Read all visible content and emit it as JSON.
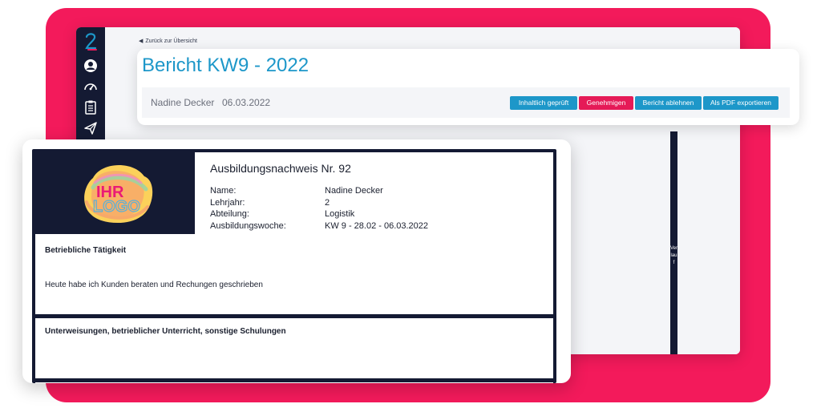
{
  "app": {
    "back_link": "Zurück zur Übersicht",
    "sidebar_icons": [
      "brand-logo-icon",
      "profile-icon",
      "dashboard-icon",
      "clipboard-icon",
      "send-icon"
    ],
    "side_panel_label": "Verlauf"
  },
  "header": {
    "title": "Bericht KW9 - 2022",
    "student_name": "Nadine Decker",
    "date": "06.03.2022",
    "buttons": {
      "checked": "Inhaltlich geprüft",
      "approve": "Genehmigen",
      "reject": "Bericht ablehnen",
      "export_pdf": "Als PDF exportieren"
    }
  },
  "document": {
    "logo_line1": "IHR",
    "logo_line2": "LOGO",
    "title": "Ausbildungsnachweis Nr. 92",
    "fields": [
      {
        "label": "Name:",
        "value": "Nadine Decker"
      },
      {
        "label": "Lehrjahr:",
        "value": "2"
      },
      {
        "label": "Abteilung:",
        "value": "Logistik"
      },
      {
        "label": "Ausbildungswoche:",
        "value": "KW 9 - 28.02 - 06.03.2022"
      }
    ],
    "sections": [
      {
        "heading": "Betriebliche Tätigkeit",
        "text": "Heute habe ich Kunden beraten und Rechungen geschrieben"
      },
      {
        "heading": "Unterweisungen, betrieblicher Unterricht, sonstige Schulungen",
        "text": ""
      }
    ]
  },
  "colors": {
    "brand_pink": "#f31a5b",
    "navy": "#141a33",
    "accent_blue": "#1d97c9",
    "approve_pink": "#e51a57"
  }
}
